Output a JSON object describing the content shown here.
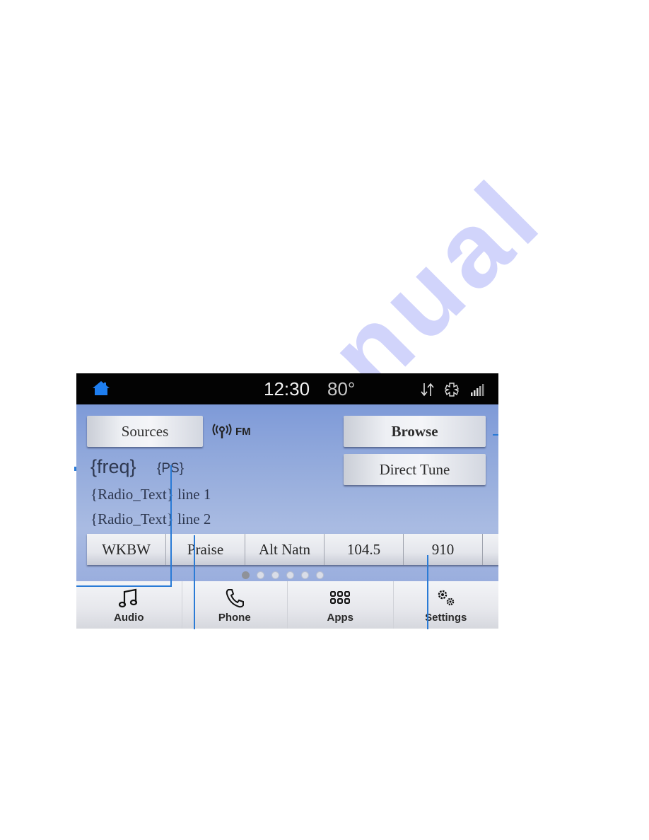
{
  "statusbar": {
    "home_icon": "home-icon",
    "time": "12:30",
    "temperature": "80°",
    "icons": [
      "data-transfer-icon",
      "climate-icon",
      "signal-strength-icon"
    ]
  },
  "radio": {
    "sources_label": "Sources",
    "band_icon": "broadcast-antenna-icon",
    "band": "FM",
    "frequency": "{freq}",
    "program_service": "{PS}",
    "radio_text_line1": "{Radio_Text} line 1",
    "radio_text_line2": "{Radio_Text} line 2",
    "browse_label": "Browse",
    "direct_tune_label": "Direct Tune"
  },
  "presets": [
    {
      "label": "WKBW"
    },
    {
      "label": "Praise"
    },
    {
      "label": "Alt Natn"
    },
    {
      "label": "104.5"
    },
    {
      "label": "910"
    },
    {
      "label": ""
    }
  ],
  "pagination": {
    "pages": 6,
    "active": 1
  },
  "nav": [
    {
      "label": "Audio",
      "icon": "music-note-icon"
    },
    {
      "label": "Phone",
      "icon": "phone-icon"
    },
    {
      "label": "Apps",
      "icon": "apps-grid-icon"
    },
    {
      "label": "Settings",
      "icon": "gears-icon"
    }
  ],
  "colors": {
    "accent_home": "#1e7ef0",
    "statusbar_bg": "#030303",
    "callout_line": "#2a7bd6"
  }
}
